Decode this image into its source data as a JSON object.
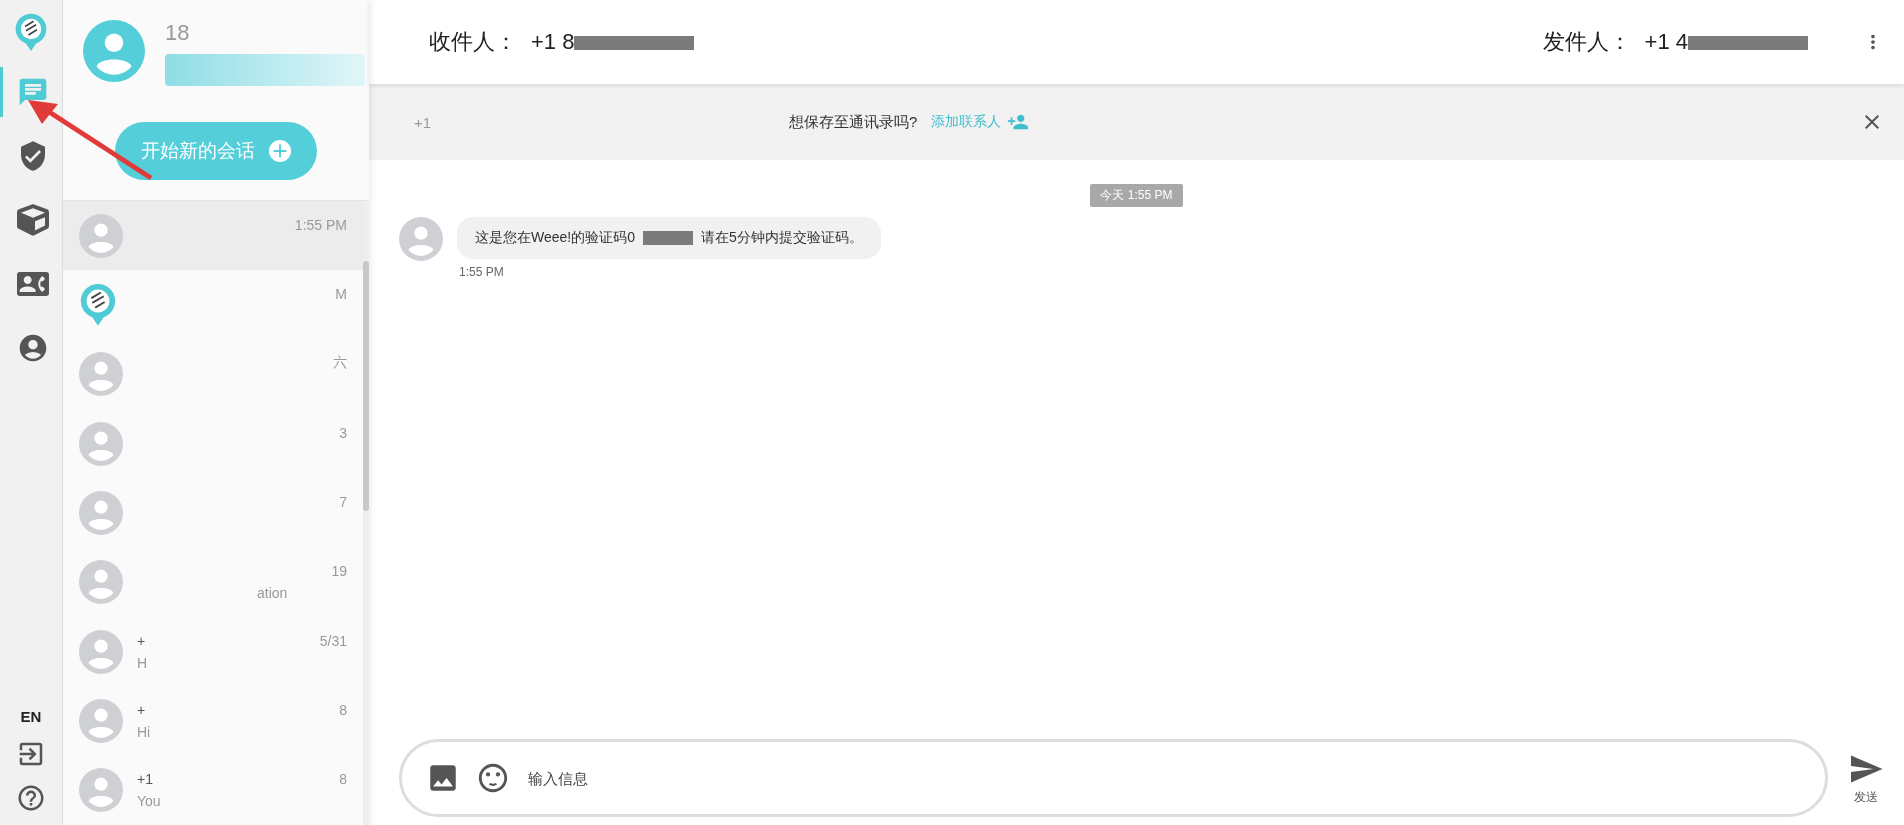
{
  "rail": {
    "items": [
      {
        "kind": "chat",
        "selected": true
      },
      {
        "kind": "shield",
        "selected": false
      },
      {
        "kind": "box",
        "selected": false
      },
      {
        "kind": "contacts",
        "selected": false
      },
      {
        "kind": "account",
        "selected": false
      }
    ],
    "language": "EN"
  },
  "profile": {
    "name": "18"
  },
  "new_chat_button": "开始新的会话",
  "conversations": [
    {
      "kind": "person",
      "time": "1:55 PM",
      "selected": true
    },
    {
      "kind": "logo",
      "time": "M",
      "selected": false
    },
    {
      "kind": "person",
      "time": "六",
      "selected": false
    },
    {
      "kind": "person",
      "time": "3",
      "selected": false
    },
    {
      "kind": "person",
      "time": "7",
      "selected": false
    },
    {
      "kind": "person",
      "time": "19",
      "preview": "ation",
      "selected": false
    },
    {
      "kind": "person",
      "name": "+",
      "time": "5/31",
      "preview": "H",
      "selected": false
    },
    {
      "kind": "person",
      "name": "+",
      "time": "8",
      "preview": "Hi",
      "selected": false
    },
    {
      "kind": "person",
      "name": "+1",
      "time": "8",
      "preview": "You",
      "selected": false
    }
  ],
  "header": {
    "recipient_label": "收件人：",
    "recipient": "+1 8",
    "sender_label": "发件人：",
    "sender": "+1 4"
  },
  "banner": {
    "number": "+1",
    "question": "想保存至通讯录吗?",
    "action": "添加联系人"
  },
  "date_chip": "今天 1:55 PM",
  "message": {
    "before": "这是您在Weee!的验证码0",
    "after": "请在5分钟内提交验证码。",
    "time": "1:55 PM"
  },
  "composer": {
    "placeholder": "输入信息",
    "send": "发送"
  }
}
